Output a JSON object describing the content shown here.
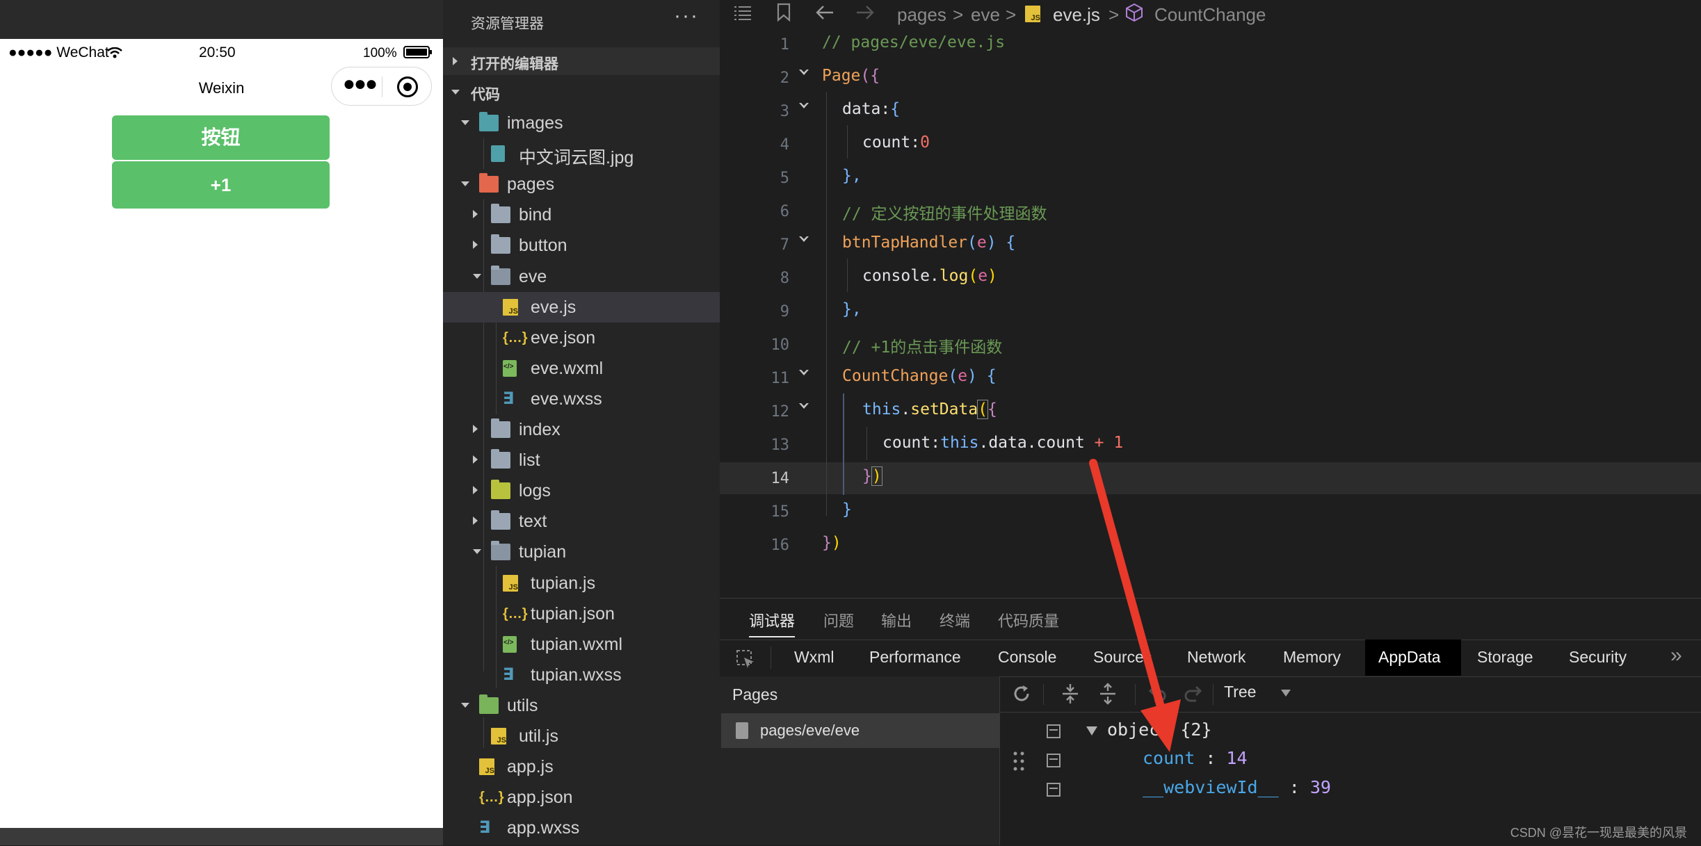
{
  "simulator": {
    "status": {
      "carrier": "●●●●● WeChat",
      "wifi": "wifi-icon",
      "time": "20:50",
      "battery": "100%"
    },
    "nav_title": "Weixin",
    "buttons": [
      {
        "label": "按钮"
      },
      {
        "label": "+1"
      }
    ]
  },
  "explorer": {
    "title": "资源管理器",
    "more": "···",
    "sections": {
      "open_editors": "打开的编辑器",
      "code": "代码"
    },
    "tree": [
      {
        "name": "images",
        "type": "folder-images",
        "depth": 0,
        "open": true
      },
      {
        "name": "中文词云图.jpg",
        "type": "image",
        "depth": 1
      },
      {
        "name": "pages",
        "type": "folder-pages",
        "depth": 0,
        "open": true
      },
      {
        "name": "bind",
        "type": "folder",
        "depth": 1,
        "open": false
      },
      {
        "name": "button",
        "type": "folder",
        "depth": 1,
        "open": false
      },
      {
        "name": "eve",
        "type": "folder",
        "depth": 1,
        "open": true
      },
      {
        "name": "eve.js",
        "type": "js",
        "depth": 2,
        "selected": true
      },
      {
        "name": "eve.json",
        "type": "json",
        "depth": 2
      },
      {
        "name": "eve.wxml",
        "type": "wxml",
        "depth": 2
      },
      {
        "name": "eve.wxss",
        "type": "wxss",
        "depth": 2
      },
      {
        "name": "index",
        "type": "folder",
        "depth": 1,
        "open": false
      },
      {
        "name": "list",
        "type": "folder",
        "depth": 1,
        "open": false
      },
      {
        "name": "logs",
        "type": "folder-logs",
        "depth": 1,
        "open": false
      },
      {
        "name": "text",
        "type": "folder",
        "depth": 1,
        "open": false
      },
      {
        "name": "tupian",
        "type": "folder",
        "depth": 1,
        "open": true
      },
      {
        "name": "tupian.js",
        "type": "js",
        "depth": 2
      },
      {
        "name": "tupian.json",
        "type": "json",
        "depth": 2
      },
      {
        "name": "tupian.wxml",
        "type": "wxml",
        "depth": 2
      },
      {
        "name": "tupian.wxss",
        "type": "wxss",
        "depth": 2
      },
      {
        "name": "utils",
        "type": "folder-utils",
        "depth": 0,
        "open": true
      },
      {
        "name": "util.js",
        "type": "js",
        "depth": 1
      },
      {
        "name": "app.js",
        "type": "js",
        "depth": 0
      },
      {
        "name": "app.json",
        "type": "json",
        "depth": 0
      },
      {
        "name": "app.wxss",
        "type": "wxss",
        "depth": 0
      }
    ]
  },
  "editor": {
    "breadcrumb": {
      "seg1": "pages",
      "seg2": "eve",
      "file": "eve.js",
      "symbol": "CountChange",
      "sep": ">"
    },
    "line_numbers": [
      "1",
      "2",
      "3",
      "4",
      "5",
      "6",
      "7",
      "8",
      "9",
      "10",
      "11",
      "12",
      "13",
      "14",
      "15",
      "16"
    ],
    "current_line": "14",
    "code": {
      "l1": "// pages/eve/eve.js",
      "l2_fn": "Page",
      "l2_b": "({",
      "l3_prop": "data:",
      "l3_b": "{",
      "l4_prop": "count:",
      "l4_num": "0",
      "l5": "},",
      "l6": "// 定义按钮的事件处理函数",
      "l7_fn": "btnTapHandler",
      "l7_p1": "(",
      "l7_param": "e",
      "l7_p2": ") {",
      "l8_obj": "console.",
      "l8_call": "log",
      "l8_p1": "(",
      "l8_param": "e",
      "l8_p2": ")",
      "l9": "},",
      "l10": "// +1的点击事件函数",
      "l11_fn": "CountChange",
      "l11_p1": "(",
      "l11_param": "e",
      "l11_p2": ") {",
      "l12_kw": "this",
      "l12_dot": ".",
      "l12_call": "setData",
      "l12_p": "(",
      "l12_b": "{",
      "l13_prop": "count:",
      "l13_kw": "this",
      "l13_rest": ".data.count ",
      "l13_op": "+",
      "l13_num": " 1",
      "l14_b": "}",
      "l14_p": ")",
      "l15": "}",
      "l16_b": "}",
      "l16_p": ")"
    }
  },
  "panel": {
    "tabs": [
      "调试器",
      "问题",
      "输出",
      "终端",
      "代码质量"
    ],
    "devtools_tabs": [
      "Wxml",
      "Performance",
      "Console",
      "Sources",
      "Network",
      "Memory",
      "AppData",
      "Storage",
      "Security"
    ],
    "active_devtool": "AppData",
    "more": "»",
    "pages_header": "Pages",
    "pages_item": "pages/eve/eve",
    "view_mode": "Tree",
    "appdata": {
      "root_label": "object",
      "root_count": "{2}",
      "rows": [
        {
          "key": "count",
          "value": "14"
        },
        {
          "key": "__webviewId__",
          "value": "39"
        }
      ],
      "sep": " : "
    }
  },
  "watermark": "CSDN @昙花一现是最美的风景",
  "colors": {
    "accent_green": "#5ac06a",
    "annotation_arrow": "#e8392a"
  }
}
